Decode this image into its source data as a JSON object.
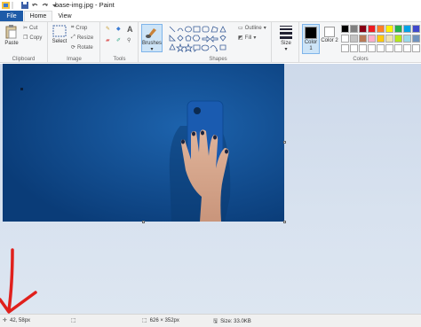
{
  "window": {
    "title": "base-img.jpg - Paint"
  },
  "tabs": {
    "file": "File",
    "home": "Home",
    "view": "View"
  },
  "clipboard": {
    "paste": "Paste",
    "cut": "Cut",
    "copy": "Copy",
    "label": "Clipboard"
  },
  "image_group": {
    "select": "Select",
    "crop": "Crop",
    "resize": "Resize",
    "rotate": "Rotate",
    "label": "Image"
  },
  "tools": {
    "label": "Tools",
    "text_tool": "A"
  },
  "brushes": {
    "label": "Brushes"
  },
  "shapes": {
    "outline": "Outline",
    "fill": "Fill",
    "label": "Shapes"
  },
  "size": {
    "label": "Size"
  },
  "colors": {
    "color1_label": "Color 1",
    "color2_label": "Color 2",
    "label": "Colors",
    "color1": "#000000",
    "color2": "#ffffff",
    "palette_row1": [
      "#000000",
      "#7f7f7f",
      "#880015",
      "#ed1c24",
      "#ff7f27",
      "#fff200",
      "#22b14c",
      "#00a2e8",
      "#3f48cc",
      "#a349a4"
    ],
    "palette_row2": [
      "#ffffff",
      "#c3c3c3",
      "#b97a57",
      "#ffaec9",
      "#ffc90e",
      "#efe4b0",
      "#b5e61d",
      "#99d9ea",
      "#7092be",
      "#c8bfe7"
    ],
    "palette_row3": [
      "#ffffff",
      "#ffffff",
      "#ffffff",
      "#ffffff",
      "#ffffff",
      "#ffffff",
      "#ffffff",
      "#ffffff",
      "#ffffff",
      "#ffffff"
    ]
  },
  "status": {
    "cursor_pos": "42, 58px",
    "image_size": "626 × 352px",
    "file_size": "Size: 33.0KB"
  }
}
